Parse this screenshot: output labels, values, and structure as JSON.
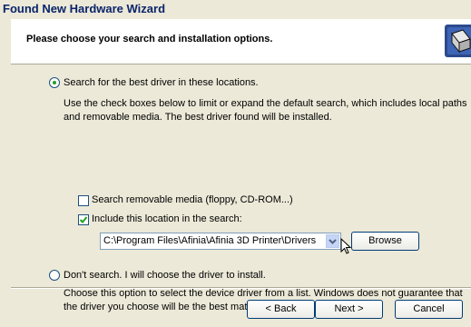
{
  "window": {
    "title": "Found New Hardware Wizard"
  },
  "header": {
    "title": "Please choose your search and installation options.",
    "icon": "hardware-wizard-icon"
  },
  "options": {
    "search": {
      "label": "Search for the best driver in these locations.",
      "description": "Use the check boxes below to limit or expand the default search, which includes local paths and removable media. The best driver found will be installed.",
      "selected": true,
      "removable_media": {
        "label": "Search removable media (floppy, CD-ROM...)",
        "checked": false
      },
      "include_location": {
        "label": "Include this location in the search:",
        "checked": true
      },
      "location_value": "C:\\Program Files\\Afinia\\Afinia 3D Printer\\Drivers",
      "browse_label": "Browse"
    },
    "dont_search": {
      "label": "Don't search. I will choose the driver to install.",
      "description": "Choose this option to select the device driver from a list. Windows does not guarantee that the driver you choose will be the best match for your hardware.",
      "selected": false
    }
  },
  "buttons": {
    "back": "< Back",
    "next": "Next >",
    "cancel": "Cancel"
  },
  "colors": {
    "accent": "#21a121",
    "title": "#0a246a"
  }
}
